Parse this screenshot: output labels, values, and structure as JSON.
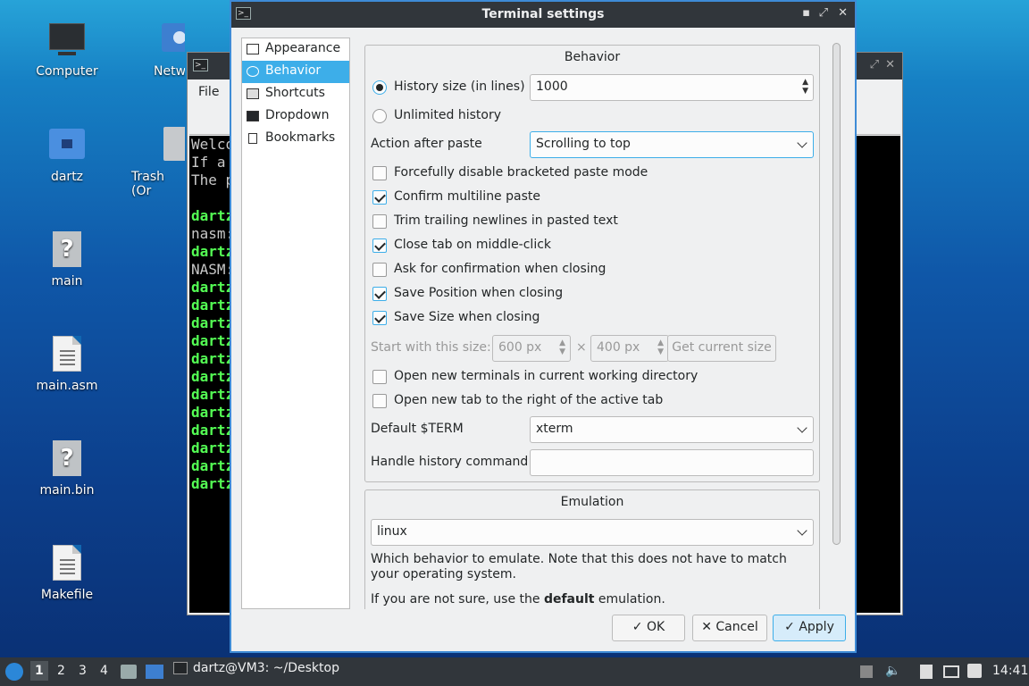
{
  "desktop": {
    "icons": [
      {
        "label": "Computer"
      },
      {
        "label": "Netw"
      },
      {
        "label": "dartz"
      },
      {
        "label": "Trash (Or"
      },
      {
        "label": "main"
      },
      {
        "label": "main.asm"
      },
      {
        "label": "main.bin"
      },
      {
        "label": "Makefile"
      }
    ]
  },
  "terminal": {
    "menu": "File",
    "lines": [
      {
        "t": "Welco",
        "c": "w"
      },
      {
        "t": "If a",
        "c": "w"
      },
      {
        "t": "The p",
        "c": "w"
      },
      {
        "t": "",
        "c": "w"
      },
      {
        "t": "dartz",
        "c": "g"
      },
      {
        "t": "nasm:",
        "c": "w"
      },
      {
        "t": "dartz",
        "c": "g"
      },
      {
        "t": "NASM:",
        "c": "w"
      },
      {
        "t": "dartz",
        "c": "g"
      },
      {
        "t": "dartz",
        "c": "g"
      },
      {
        "t": "dartz",
        "c": "g"
      },
      {
        "t": "dartz",
        "c": "g"
      },
      {
        "t": "dartz",
        "c": "g"
      },
      {
        "t": "dartz",
        "c": "g"
      },
      {
        "t": "dartz",
        "c": "g"
      },
      {
        "t": "dartz",
        "c": "g"
      },
      {
        "t": "dartz",
        "c": "g"
      },
      {
        "t": "dartz",
        "c": "g"
      },
      {
        "t": "dartz",
        "c": "g"
      },
      {
        "t": "dartz",
        "c": "g"
      }
    ]
  },
  "dialog": {
    "title": "Terminal settings",
    "nav": [
      {
        "label": "Appearance",
        "icon": "appearance-icon"
      },
      {
        "label": "Behavior",
        "icon": "behavior-icon",
        "selected": true
      },
      {
        "label": "Shortcuts",
        "icon": "keyboard-icon"
      },
      {
        "label": "Dropdown",
        "icon": "dropdown-icon"
      },
      {
        "label": "Bookmarks",
        "icon": "bookmark-icon"
      }
    ],
    "behavior": {
      "group_title": "Behavior",
      "history_size_label": "History size (in lines)",
      "history_size_value": "1000",
      "unlimited_label": "Unlimited history",
      "action_after_paste_label": "Action after paste",
      "action_after_paste_value": "Scrolling to top",
      "forcefully_disable": "Forcefully disable bracketed paste mode",
      "confirm_multiline": "Confirm multiline paste",
      "trim_newlines": "Trim trailing newlines in pasted text",
      "close_tab_middle": "Close tab on middle-click",
      "ask_confirmation": "Ask for confirmation when closing",
      "save_position": "Save Position when closing",
      "save_size": "Save Size when closing",
      "start_size_label": "Start with this size:",
      "width_value": "600 px",
      "times": "×",
      "height_value": "400 px",
      "get_current_size": "Get current size",
      "open_new_terminals": "Open new terminals in current working directory",
      "open_new_tab": "Open new tab to the right of the active tab",
      "default_term_label": "Default $TERM",
      "default_term_value": "xterm",
      "handle_history_label": "Handle history command",
      "handle_history_value": ""
    },
    "emulation": {
      "group_title": "Emulation",
      "value": "linux",
      "desc": "Which behavior to emulate. Note that this does not have to match your operating system.",
      "hint_pre": "If you are not sure, use the ",
      "hint_bold": "default",
      "hint_post": " emulation."
    },
    "buttons": {
      "ok": "OK",
      "cancel": "Cancel",
      "apply": "Apply"
    }
  },
  "taskbar": {
    "workspaces": [
      "1",
      "2",
      "3",
      "4"
    ],
    "task": "dartz@VM3: ~/Desktop",
    "clock": "14:41"
  }
}
